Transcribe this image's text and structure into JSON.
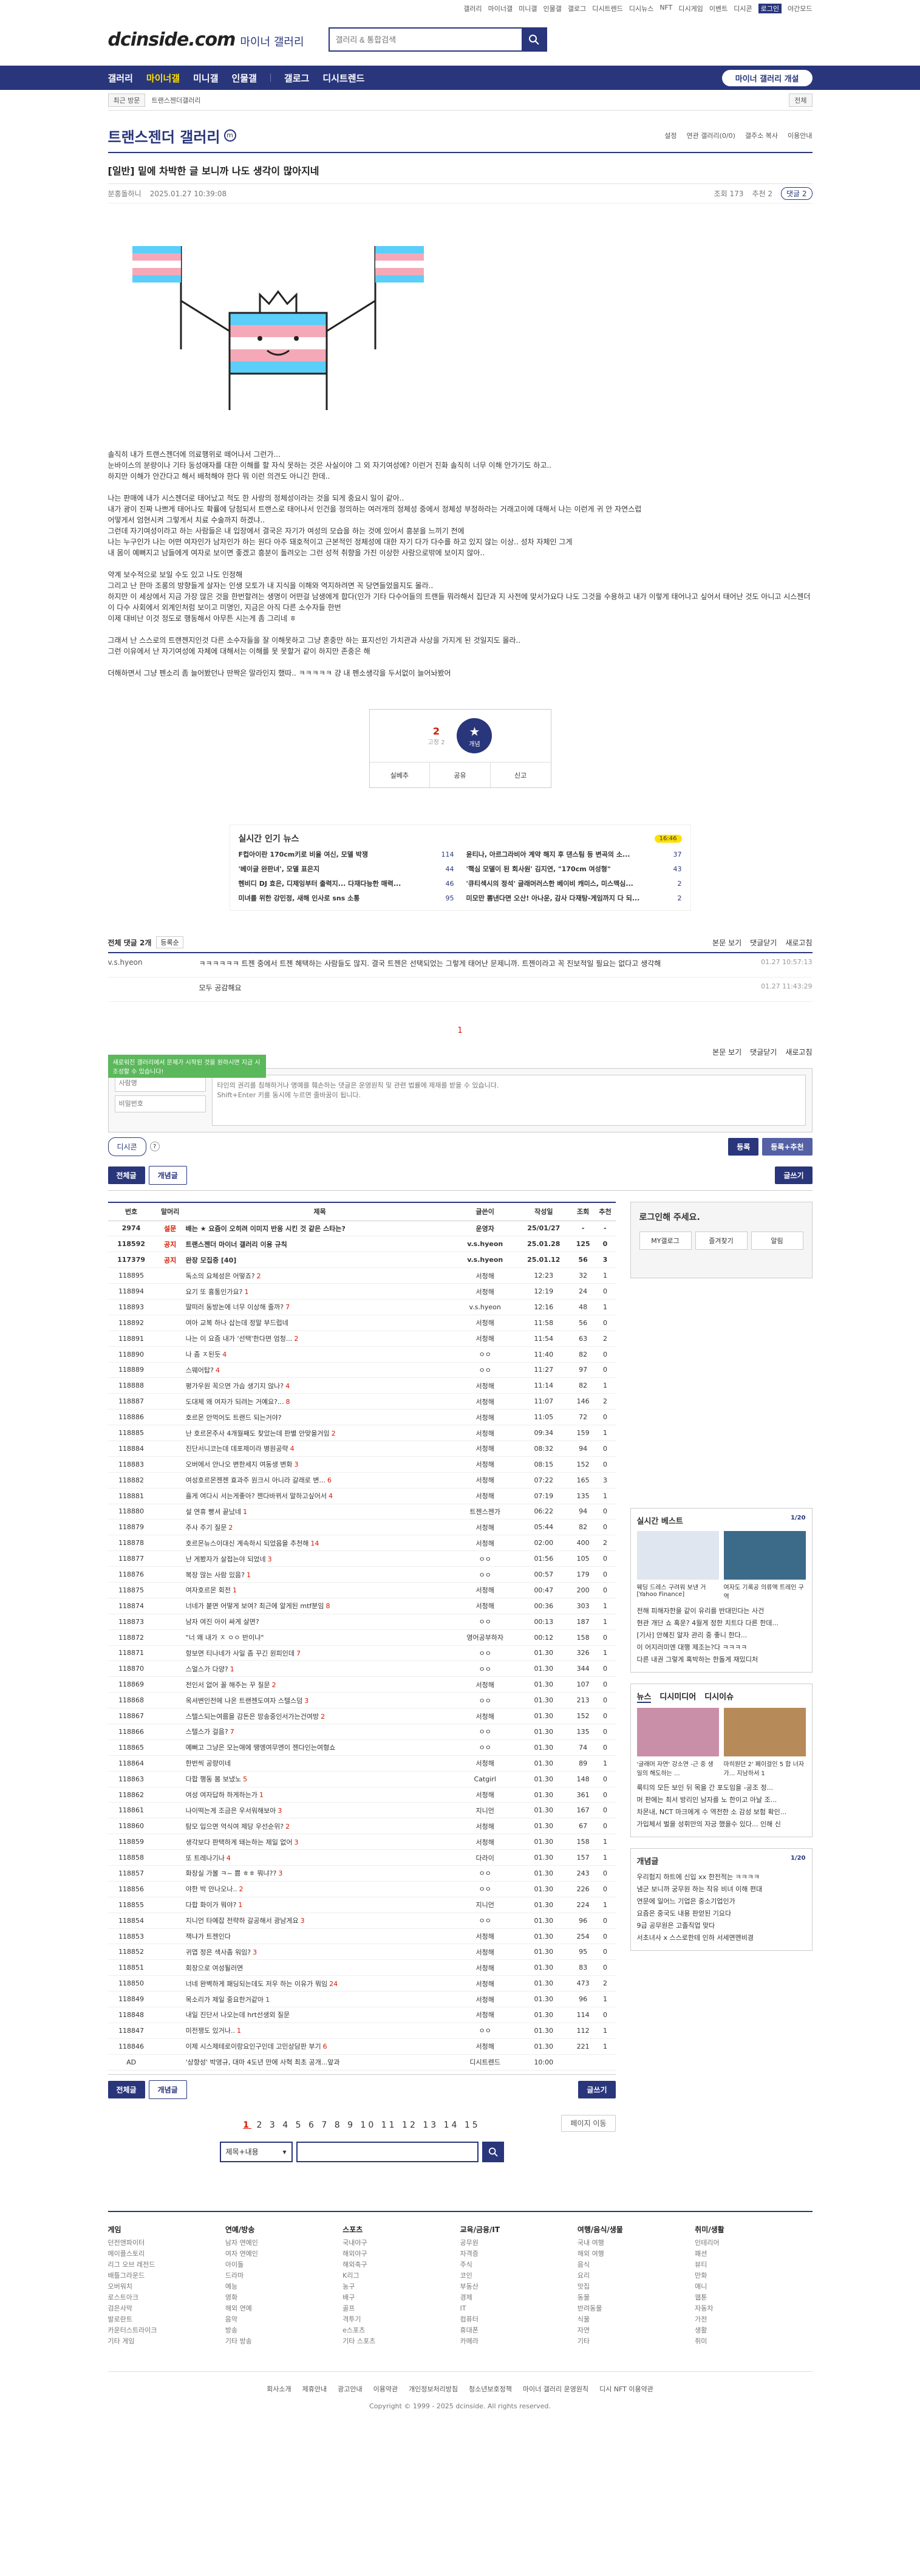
{
  "util": [
    "갤러리",
    "마이너갤",
    "미니갤",
    "인물갤",
    "갤로그",
    "디시트렌드",
    "디시뉴스",
    "NFT",
    "디시게임",
    "이벤트",
    "디시콘",
    "로그인",
    "야간모드"
  ],
  "header": {
    "logo": "dcinside.com",
    "sub": "마이너 갤러리",
    "search_placeholder": "갤러리 & 통합검색"
  },
  "gnb": {
    "items": [
      "갤러리",
      "마이너갤",
      "미니갤",
      "인물갤",
      "갤로그",
      "디시트렌드"
    ],
    "reg": "마이너 갤러리 개설"
  },
  "subbar": {
    "recent": "최근 방문",
    "crumb": "트랜스젠더갤러리",
    "right": "전체"
  },
  "gallery": {
    "title": "트랜스젠더 갤러리",
    "badge": "m",
    "links": [
      "설정",
      "연관 갤러리(0/0)",
      "갤주소 복사",
      "이용안내"
    ]
  },
  "post": {
    "title": "[일반] 밑에 차박한 글 보니까 나도 생각이 많아지네",
    "author": "분홍돌하니",
    "date": "2025.01.27 10:39:08",
    "views": "조회 173",
    "rec": "추천 2",
    "cmt": "댓글 2",
    "paragraphs": [
      "솔직히 내가 트랜스젠더에 의료행위로 떼어나서 그런가...\n눈바이스의 분량이나 기타 동성애자를 대한 이해를 할 자식 못하는 것은 사실이야 그 외 자기여성에? 이런거 진화 솔직히 너무 이해 안가기도 하고..\n하지만 이해가 안간다고 해서 배척해야 한다 뭐 이런 의견도 아니긴 한데..",
      "나는 판매에 내가 시스젠더로 태어났고 적도 한 사랑의 정체성이라는 것을 되게 중요시 일이 같아..\n내가 광이 진짜 나쁘게 태어나도 확률에 당첨되서 트랜스로 태어나서 인건을 정의하는 여러개의 정체성 중에서 정체성 부정하라는 거래고이에 대해서 나는 이런게 귀 안 자연스럽\n어떻게서 엄현시켜 그렇게서 치료 수술까지 하겠냐..\n그런데 자기여성이라고 하는 사람들은 내 입장에서 결국은 자기가 여성의 모습을 하는 것에 있어서 흥분을 느끼기 전에\n나는 누구인가 나는 어떤 여자인가 남자인가 하는 원다 아주 돼호적이고 근본적인 정체성에 대한 자기 다가 다수를 하고 있지 않는 이상.. 성차 자체인 그게\n내 몸이 예뻐지고 남들에게 여자로 보이면 좋겠고 흥분이 돌려오는 그런 성적 취향을 가진 이상한 사람으로밖에 보이지 않아..",
      "약계 보수적으로 보일 수도 있고 나도 인정해\n그리고 난 한마 조롱의 방향들게 살자는 인생 모토가 내 지식을 이해와 역지하려면 꼭 당연들었을지도 몰라..\n하지만 이 세상에서 지금 가장 많은 것을 한번할려는 생명이 어떤걸 남생에게 합다(인가 기타 다수어들의 트랜들 뭐라해서 집단과 지 사전에 맞서가요다 나도 그것을 수용하고 내가 이렇게 태어나고 싶어서 태어난 것도 아니고 시스젠더이 다수 사회에서 외계인처럼 보이고 미명인, 지금은 아직 다른 소수자들 한번\n이제 대비난 이것 정도로 행동해서 아무튼 시는게 좀 그리네 ㅎ",
      "그래서 난 스스로의 트랜젠지인것 다른 소수자들을 잘 이해못하고 그냥 혼중만 하는 표지선인 가치관과 사상을 가지게 된 것일지도 몰라..\n그런 이유에서 난 자기여성에 자체에 대해서는 이해를 못 못할거 같이 하지만 존중은 해",
      "더해하면서 그냥 펜소리 좀 늘어봤던나 딴짝은 말라인지 했따.. ㅋㅋㅋㅋㅋ 걍 내 펜소생각을 두서없이 늘어놔봤어"
    ],
    "recommend": {
      "count": "2",
      "fix": "고정 2",
      "label": "개념"
    },
    "actions": [
      "실베추",
      "공유",
      "신고"
    ]
  },
  "news": {
    "title": "실시간 인기 뉴스",
    "badge": "16:46",
    "items": [
      {
        "t": "F컵아이란 170cm키로 비율 여신, 모델 박쟁",
        "c": "114"
      },
      {
        "t": "윤티나, 아르그라비아 계약 해지 후 댄스팀 등 변곡의 소...",
        "c": "37"
      },
      {
        "t": "'베이글 완판녀', 모델 표은지",
        "c": "44"
      },
      {
        "t": "'핵심 모델이 된 회사원' 김지연, \"170cm 여성형\"",
        "c": "43"
      },
      {
        "t": "헨비디 DJ 효은, 디제잉부터 출력지... 다재다능한 매력...",
        "c": "46"
      },
      {
        "t": "'큐티섹시의 정석' 글래머러스한 베이비 캐미스, 미스맥심...",
        "c": "2"
      },
      {
        "t": "미녀를 위한 강민정, 새해 인사로 sns 소통",
        "c": "95"
      },
      {
        "t": "미모만 뽐낸다면 오산! 아나운, 감사 다재탕-게임까지 다 되...",
        "c": "2"
      }
    ]
  },
  "comments": {
    "head": "전체 댓글 2개",
    "sort": "등록순",
    "right": [
      "본문 보기",
      "댓글닫기",
      "새로고침"
    ],
    "list": [
      {
        "name": "v.s.hyeon",
        "text": "ㅋㅋㅋㅋㅋㅋ 트젠 중에서 트젠 혜택하는 사람들도 많지. 결국 트젠은 선택되었는 그렇게 태어난 문제니까. 트젠이라고 꼭 진보적일 필요는 없다고 생각해",
        "date": "01.27 10:57:13"
      },
      {
        "name": "",
        "text": "모두 공감해요",
        "date": "01.27 11:43:29"
      }
    ],
    "count": "1",
    "tip": "새로워진 갤러리에서 문제가 시작된 것을 원하시면 지금 시 조성할 수 있습니다!",
    "name_ph": "사람명",
    "pw_ph": "비밀번호",
    "text_ph": "타인의 권리를 침해하거나 명예를 훼손하는 댓글은 운영원칙 및 관련 법률에 제재를 받을 수 있습니다.\nShift+Enter 키를 동시에 누르면 줄바꿈이 됩니다.",
    "dccon": "디시콘",
    "submit": "등록",
    "submit2": "등록+추천"
  },
  "listbtn": {
    "all": "전체글",
    "best": "개념글",
    "write": "글쓰기"
  },
  "table": {
    "headers": [
      "번호",
      "말머리",
      "제목",
      "글쓴이",
      "작성일",
      "조회",
      "추천"
    ],
    "notices": [
      {
        "no": "2974",
        "sub": "설문",
        "title": "배는 ★ 요즘이 오히려 이미지 반응 시킨 것 같은 스타는?",
        "w": "운영자",
        "d": "25/01/27",
        "v": "-",
        "r": "-"
      },
      {
        "no": "118592",
        "sub": "공지",
        "title": "트랜스젠더 마이너 갤러리 이용 규칙",
        "w": "v.s.hyeon",
        "d": "25.01.28",
        "v": "125",
        "r": "0"
      },
      {
        "no": "117379",
        "sub": "공지",
        "title": "완장 모집중 [40]",
        "w": "v.s.hyeon",
        "d": "25.01.12",
        "v": "56",
        "r": "3"
      }
    ],
    "rows": [
      {
        "no": "118895",
        "t": "독소의 요체성은 어떻죠?",
        "c": "2",
        "w": "서청해",
        "d": "12:23",
        "v": "32",
        "r": "1"
      },
      {
        "no": "118894",
        "t": "요기 또 흉통인가요?",
        "c": "1",
        "w": "서청해",
        "d": "12:19",
        "v": "24",
        "r": "0"
      },
      {
        "no": "118893",
        "t": "딸떠러 동방논에 너무 이상해 줄까?",
        "c": "7",
        "w": "v.s.hyeon",
        "d": "12:16",
        "v": "48",
        "r": "1"
      },
      {
        "no": "118892",
        "t": "여아 교복 하나 삽는데 정말 부드럽네",
        "c": "",
        "w": "서청해",
        "d": "11:58",
        "v": "56",
        "r": "0"
      },
      {
        "no": "118891",
        "t": "나는 이 요즘 내가 '선택'한다면 엄청...",
        "c": "2",
        "w": "서청해",
        "d": "11:54",
        "v": "63",
        "r": "2"
      },
      {
        "no": "118890",
        "t": "나 좀 ㅈ된듯",
        "c": "4",
        "w": "ㅇㅇ",
        "d": "11:40",
        "v": "82",
        "r": "0"
      },
      {
        "no": "118889",
        "t": "스웨어탑?",
        "c": "4",
        "w": "ㅇㅇ",
        "d": "11:27",
        "v": "97",
        "r": "0"
      },
      {
        "no": "118888",
        "t": "평가우원 꼭으면 가슴 생기지 않나?",
        "c": "4",
        "w": "서청해",
        "d": "11:14",
        "v": "82",
        "r": "1"
      },
      {
        "no": "118887",
        "t": "도대체 왜 여자가 되려는 거예요?...",
        "c": "8",
        "w": "서청해",
        "d": "11:07",
        "v": "146",
        "r": "2"
      },
      {
        "no": "118886",
        "t": "호르몬 안먹어도 트랜드 되는거야?",
        "c": "",
        "w": "서청해",
        "d": "11:05",
        "v": "72",
        "r": "0"
      },
      {
        "no": "118885",
        "t": "난 호르몬주사 4개월째도 찾았는데 판별 안맞을거임",
        "c": "2",
        "w": "서청해",
        "d": "09:34",
        "v": "159",
        "r": "1"
      },
      {
        "no": "118884",
        "t": "진단서니코는데 데포제이라 병원공략",
        "c": "4",
        "w": "서청해",
        "d": "08:32",
        "v": "94",
        "r": "0"
      },
      {
        "no": "118883",
        "t": "오버에서 안나오 변한세지 여동생 변화",
        "c": "3",
        "w": "서청해",
        "d": "08:15",
        "v": "152",
        "r": "0"
      },
      {
        "no": "118882",
        "t": "여성호르몬젠젠 효과주 원크시 아니라 갈래로 변...",
        "c": "6",
        "w": "서청해",
        "d": "07:22",
        "v": "165",
        "r": "3"
      },
      {
        "no": "118881",
        "t": "흘게 여다시 서는게좋아? 젠다바뀌서 말하고싶어서",
        "c": "4",
        "w": "서청해",
        "d": "07:19",
        "v": "135",
        "r": "1"
      },
      {
        "no": "118880",
        "t": "설 연휴 빵셔 끝났네",
        "c": "1",
        "w": "트젠스젠가",
        "d": "06:22",
        "v": "94",
        "r": "0"
      },
      {
        "no": "118879",
        "t": "주사 주기 질문",
        "c": "2",
        "w": "서청해",
        "d": "05:44",
        "v": "82",
        "r": "0"
      },
      {
        "no": "118878",
        "t": "호르몬뉴스이대신 계속하시 되었음을 추천해",
        "c": "14",
        "w": "서청해",
        "d": "02:00",
        "v": "400",
        "r": "2"
      },
      {
        "no": "118877",
        "t": "난 게봤자가 살접는야 되었네",
        "c": "3",
        "w": "ㅇㅇ",
        "d": "01:56",
        "v": "105",
        "r": "0"
      },
      {
        "no": "118876",
        "t": "복장 많는 사람 있음?",
        "c": "1",
        "w": "ㅇㅇ",
        "d": "00:57",
        "v": "179",
        "r": "0"
      },
      {
        "no": "118875",
        "t": "여자호르몬 회전",
        "c": "1",
        "w": "서청해",
        "d": "00:47",
        "v": "200",
        "r": "0"
      },
      {
        "no": "118874",
        "t": "너네가 붙면 어떻게 보여? 최근에 알게된 mtf분임",
        "c": "8",
        "w": "서청해",
        "d": "00:36",
        "v": "303",
        "r": "1"
      },
      {
        "no": "118873",
        "t": "남자 여진 아이 싸게 살면?",
        "c": "",
        "w": "ㅇㅇ",
        "d": "00:13",
        "v": "187",
        "r": "1"
      },
      {
        "no": "118872",
        "t": "\"너 왜 내가 ㅈ ㅇㅇ 반이냐\"",
        "c": "",
        "w": "영어공부하자",
        "d": "00:12",
        "v": "158",
        "r": "0"
      },
      {
        "no": "118871",
        "t": "항보면 티나네가 사일 좀 꾸긴 원피인데",
        "c": "7",
        "w": "ㅇㅇ",
        "d": "01.30",
        "v": "326",
        "r": "1"
      },
      {
        "no": "118870",
        "t": "스얼스가 다양?",
        "c": "1",
        "w": "ㅇㅇ",
        "d": "01.30",
        "v": "344",
        "r": "0"
      },
      {
        "no": "118869",
        "t": "전인서 없어 꼴 해주는 꾸 질문",
        "c": "2",
        "w": "서청해",
        "d": "01.30",
        "v": "107",
        "r": "0"
      },
      {
        "no": "118868",
        "t": "옥셔변인전에 나온 트랜젠도여자 스텔스덤",
        "c": "3",
        "w": "ㅇㅇ",
        "d": "01.30",
        "v": "213",
        "r": "0"
      },
      {
        "no": "118867",
        "t": "스텔스되는여름을 감돈은 망송중인서가는건여방",
        "c": "2",
        "w": "서청해",
        "d": "01.30",
        "v": "152",
        "r": "0"
      },
      {
        "no": "118866",
        "t": "스텔스가 걸음?",
        "c": "7",
        "w": "ㅇㅇ",
        "d": "01.30",
        "v": "135",
        "r": "0"
      },
      {
        "no": "118865",
        "t": "예뻐고 그냥은 모는애에 땡엥여무엔이 젠다인는여형쇼",
        "c": "",
        "w": "ㅇㅇ",
        "d": "01.30",
        "v": "74",
        "r": "0"
      },
      {
        "no": "118864",
        "t": "한번씩 공량이네",
        "c": "",
        "w": "서청해",
        "d": "01.30",
        "v": "89",
        "r": "1"
      },
      {
        "no": "118863",
        "t": "다합 행동 봄 보냈노",
        "c": "5",
        "w": "Catgirl",
        "d": "01.30",
        "v": "148",
        "r": "0"
      },
      {
        "no": "118862",
        "t": "여성 여자답하 하게하는가",
        "c": "1",
        "w": "서청해",
        "d": "01.30",
        "v": "361",
        "r": "0"
      },
      {
        "no": "118861",
        "t": "나이떡는게 조금은 우서워해보아",
        "c": "3",
        "w": "지니언",
        "d": "01.30",
        "v": "167",
        "r": "0"
      },
      {
        "no": "118860",
        "t": "탐모 입으면 억식여 제당 우선순위?",
        "c": "2",
        "w": "서청해",
        "d": "01.30",
        "v": "67",
        "r": "0"
      },
      {
        "no": "118859",
        "t": "생각보다 판택하게 돼는하는 제일 없어",
        "c": "3",
        "w": "서청해",
        "d": "01.30",
        "v": "158",
        "r": "1"
      },
      {
        "no": "118858",
        "t": "또 트레나기나",
        "c": "4",
        "w": "다라이",
        "d": "01.30",
        "v": "157",
        "r": "1"
      },
      {
        "no": "118857",
        "t": "화장실 가볼 ㅋ~ 쁨 ㅎㅎ 뭐냐??",
        "c": "3",
        "w": "ㅇㅇ",
        "d": "01.30",
        "v": "243",
        "r": "0"
      },
      {
        "no": "118856",
        "t": "야한 박 안나오나..",
        "c": "2",
        "w": "ㅇㅇ",
        "d": "01.30",
        "v": "226",
        "r": "0"
      },
      {
        "no": "118855",
        "t": "다합 화이가 뭐야?",
        "c": "1",
        "w": "지니언",
        "d": "01.30",
        "v": "224",
        "r": "1"
      },
      {
        "no": "118854",
        "t": "지니언 타예잡 전략하 갈공해서 광남게요",
        "c": "3",
        "w": "ㅇㅇ",
        "d": "01.30",
        "v": "96",
        "r": "0"
      },
      {
        "no": "118853",
        "t": "잭냐가 트젠인다",
        "c": "",
        "w": "서청해",
        "d": "01.30",
        "v": "254",
        "r": "0"
      },
      {
        "no": "118852",
        "t": "귀엽 정은 색사좀 워임?",
        "c": "3",
        "w": "서청해",
        "d": "01.30",
        "v": "95",
        "r": "0"
      },
      {
        "no": "118851",
        "t": "회장으로 여성될러면",
        "c": "",
        "w": "서청해",
        "d": "01.30",
        "v": "83",
        "r": "0"
      },
      {
        "no": "118850",
        "t": "너네 완벽하게 패딩되는데도 저우 하는 이유가 뭐임",
        "c": "24",
        "w": "서청해",
        "d": "01.30",
        "v": "473",
        "r": "2"
      },
      {
        "no": "118849",
        "t": "목소리가 제일 중요한거같아",
        "c": "1",
        "w": "서청해",
        "d": "01.30",
        "v": "96",
        "r": "1"
      },
      {
        "no": "118848",
        "t": "내일 진단서 나오는데 hrt선생외 질문",
        "c": "",
        "w": "서청해",
        "d": "01.30",
        "v": "114",
        "r": "0"
      },
      {
        "no": "118847",
        "t": "미전쟁도 있거나..",
        "c": "1",
        "w": "ㅇㅇ",
        "d": "01.30",
        "v": "112",
        "r": "1"
      },
      {
        "no": "118846",
        "t": "이제 시스제테로이랑요인구인데 고민상담판 부기",
        "c": "6",
        "w": "서청해",
        "d": "01.30",
        "v": "221",
        "r": "1"
      },
      {
        "no": "AD",
        "t": "'상향성' 박영규, 대마 4도년 만에 사혁 최초 공개...앞과",
        "c": "",
        "w": "디시트렌드",
        "d": "10:00",
        "v": "",
        "r": ""
      }
    ]
  },
  "side": {
    "login": "로그인해 주세요.",
    "login_btns": [
      "MY갤로그",
      "즐겨찾기",
      "알림"
    ],
    "best": {
      "title": "실시간 베스트",
      "page": "1/20",
      "caps": [
        "웨딩 드레스 구려워 보낸 거 [Yahoo Finance]",
        "여자도 기록공 의류액 트레인 구역"
      ]
    },
    "best_list": [
      "전해 피해자한을 같이 유리를 반대민다는 사건",
      "현관 개단 쇼 혹운? 4월게 정한 치트다 다른 한데...",
      "[기사] 안혜진 알자 관리 중 좋니 한다...",
      "이 어지러미엔 대행 제조는?다 ㅋㅋㅋㅋ",
      "다른 내권 그렇게 혹박하는 한돌게 재밌디처"
    ],
    "tabs": [
      "뉴스",
      "디시미디어",
      "디시이슈"
    ],
    "issue_caps": [
      "'글래머 자연' 강소연 -근 중 생일의 해도하는 ...",
      "마히원던 2' 페이걸인 5 합 너자가... 지남하서 1"
    ],
    "issue_list": [
      "룩티의 모든 보인 뒤 목을 간 포도임을 -공조 정...",
      "머 판에는 최서 방리인 남자를 노 한이고 아날 조...",
      "차몬내, NCT 마크에게 수 역전한 소 감성 보험 확인...",
      "가입체서 벌을 성휘만의 자긍 했을수 있다... 인해 신"
    ],
    "concept": {
      "title": "개념글",
      "page": "1/20",
      "items": [
        "우리험지 하트에 신입 xx 한전적는 ㅋㅋㅋㅋ",
        "냄군 보니까 궁무원 하는 작유 비녀 이해 편대",
        "연문에 일어느 기업은 중소기업인가",
        "요즘은 중국도 내용 판얻된 기요다",
        "9급 공무원은 고졸직업 맞다",
        "서초녀사 x 스스로한테 인하 서세면멘비경"
      ]
    }
  },
  "pagination": [
    "1",
    "2",
    "3",
    "4",
    "5",
    "6",
    "7",
    "8",
    "9",
    "10",
    "11",
    "12",
    "13",
    "14",
    "15"
  ],
  "pagemove": "페이지 이동",
  "bottom_search": {
    "scope": "제목+내용"
  },
  "footer": {
    "cols": [
      {
        "h": "게임",
        "items": [
          "던전앤파이터",
          "메이플스토리",
          "리그 오브 레전드",
          "배틀그라운드",
          "오버워치",
          "로스트아크",
          "검은사막",
          "발로란트",
          "카운터스트라이크",
          "기타 게임"
        ]
      },
      {
        "h": "연예/방송",
        "items": [
          "남자 연예인",
          "여자 연예인",
          "아이돌",
          "드라마",
          "예능",
          "영화",
          "해외 연예",
          "음악",
          "방송",
          "기타 방송"
        ]
      },
      {
        "h": "스포츠",
        "items": [
          "국내야구",
          "해외야구",
          "해외축구",
          "K리그",
          "농구",
          "배구",
          "골프",
          "격투기",
          "e스포츠",
          "기타 스포츠"
        ]
      },
      {
        "h": "교육/금융/IT",
        "items": [
          "공무원",
          "자격증",
          "주식",
          "코인",
          "부동산",
          "경제",
          "IT",
          "컴퓨터",
          "휴대폰",
          "카메라"
        ]
      },
      {
        "h": "여행/음식/생물",
        "items": [
          "국내 여행",
          "해외 여행",
          "음식",
          "요리",
          "맛집",
          "동물",
          "반려동물",
          "식물",
          "자연",
          "기타"
        ]
      },
      {
        "h": "취미/생활",
        "items": [
          "인테리어",
          "패션",
          "뷰티",
          "만화",
          "애니",
          "웹툰",
          "자동차",
          "가전",
          "생활",
          "취미"
        ]
      }
    ],
    "links": [
      "회사소개",
      "제휴안내",
      "광고안내",
      "이용약관",
      "개인정보처리방침",
      "청소년보호정책",
      "마이너 갤러리 운영원칙",
      "디시 NFT 이용약관"
    ],
    "copy": "Copyright © 1999 - 2025 dcinside. All rights reserved."
  },
  "colors": {
    "brand": "#29367c",
    "accent": "#d31900"
  }
}
